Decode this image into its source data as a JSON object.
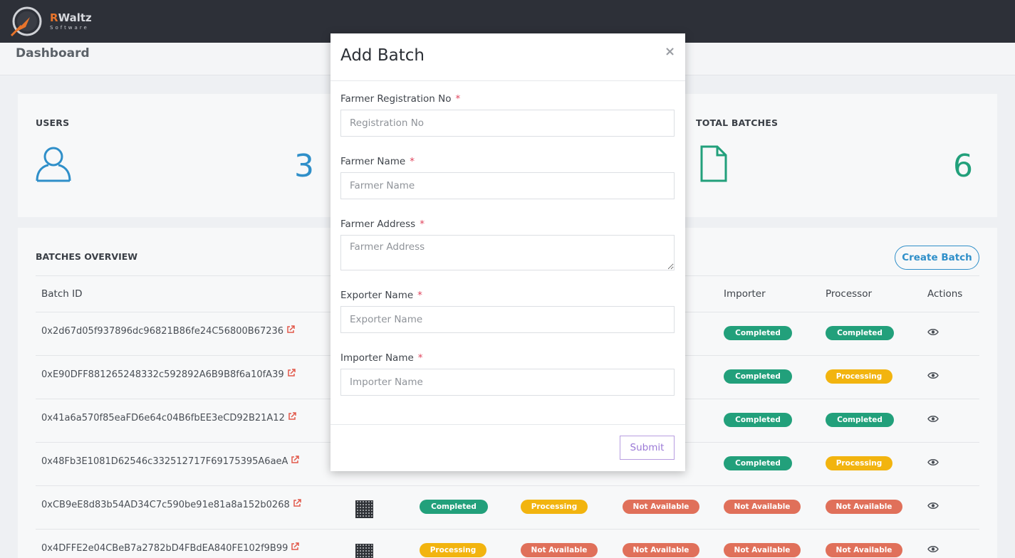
{
  "brand": {
    "logo_letter": "R",
    "logo_name_rest": "Waltz",
    "logo_sub": "Software"
  },
  "page": {
    "title": "Dashboard"
  },
  "stats": {
    "users": {
      "label": "USERS",
      "value": "3",
      "color": "#2f8fc9"
    },
    "total_batches": {
      "label": "TOTAL BATCHES",
      "value": "6",
      "color": "#22a07b"
    }
  },
  "batches": {
    "title": "BATCHES OVERVIEW",
    "create_label": "Create Batch",
    "columns": [
      "Batch ID",
      "Importer",
      "Processor",
      "Actions"
    ],
    "rows": [
      {
        "id": "0x2d67d05f937896dc96821B86fe24C56800B67236",
        "s3": "",
        "s4": "Completed",
        "s5": "Completed"
      },
      {
        "id": "0xE90DFF881265248332c592892A6B9B8f6a10fA39",
        "s3": "",
        "s4": "Completed",
        "s5": "Processing"
      },
      {
        "id": "0x41a6a570f85eaFD6e64c04B6fbEE3eCD92B21A12",
        "s3": "",
        "s4": "Completed",
        "s5": "Completed"
      },
      {
        "id": "0x48Fb3E1081D62546c332512717F69175395A6aeA",
        "s3": "",
        "s4": "Completed",
        "s5": "Processing"
      },
      {
        "id": "0xCB9eE8d83b54AD34C7c590be91e81a8a152b0268",
        "s1": "Completed",
        "s2": "Processing",
        "s3": "Not Available",
        "s4": "Not Available",
        "s5": "Not Available"
      },
      {
        "id": "0x4DFFE2e04CBeB7a2782bD4FBdEA840FE102f9B99",
        "s1": "Processing",
        "s2": "Not Available",
        "s3": "Not Available",
        "s4": "Not Available",
        "s5": "Not Available"
      }
    ]
  },
  "modal": {
    "title": "Add Batch",
    "close": "×",
    "required_mark": "*",
    "fields": [
      {
        "label": "Farmer Registration No",
        "placeholder": "Registration No"
      },
      {
        "label": "Farmer Name",
        "placeholder": "Farmer Name"
      },
      {
        "label": "Farmer Address",
        "placeholder": "Farmer Address"
      },
      {
        "label": "Exporter Name",
        "placeholder": "Exporter Name"
      },
      {
        "label": "Importer Name",
        "placeholder": "Importer Name"
      }
    ],
    "submit_label": "Submit"
  }
}
